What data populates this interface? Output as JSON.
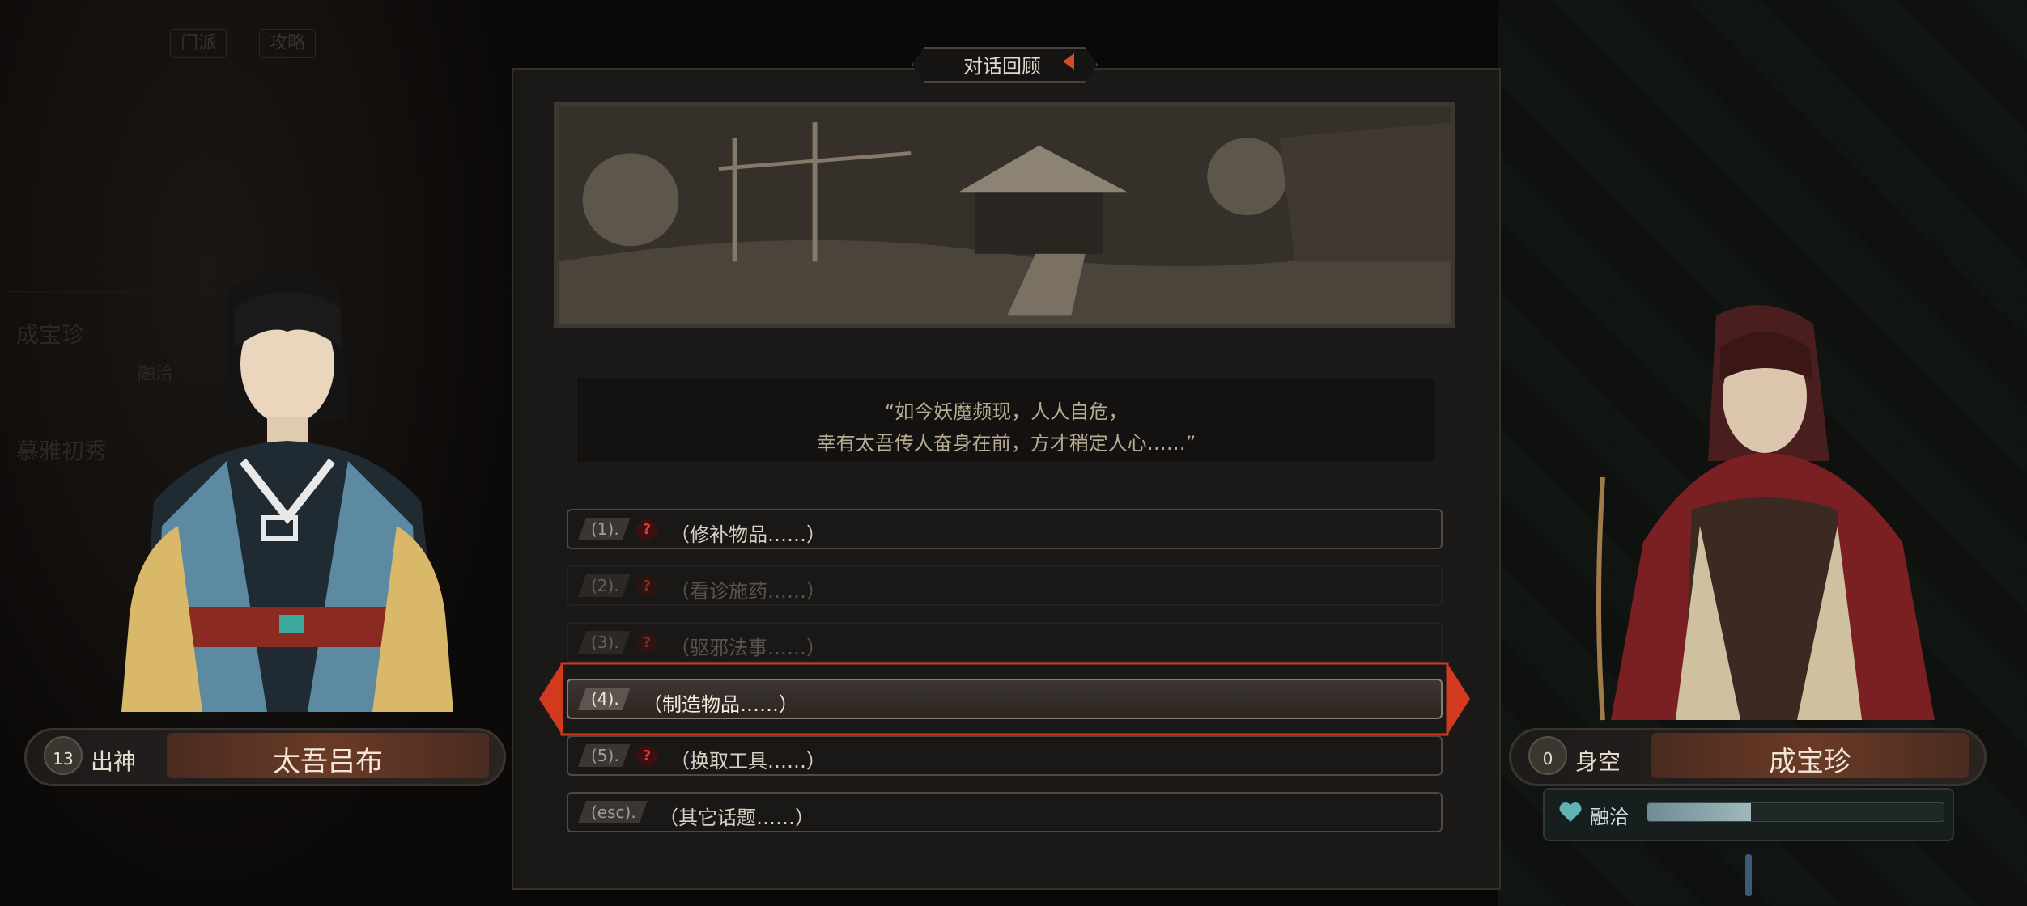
{
  "background": {
    "top_tabs": [
      "门派",
      "攻略"
    ],
    "left_list": [
      {
        "name": "成宝珍",
        "relation": "融洽"
      },
      {
        "name": "慕雅初秀",
        "relation": ""
      }
    ],
    "left_relation_label": "融洽"
  },
  "dialog": {
    "title": "对话回顾",
    "quote_lines": [
      "“如今妖魔频现，人人自危，",
      "幸有太吾传人奋身在前，方才稍定人心……”"
    ],
    "options": [
      {
        "key": "(1).",
        "label": "（修补物品……）",
        "locked": true,
        "dim": false,
        "selected": false
      },
      {
        "key": "(2).",
        "label": "（看诊施药……）",
        "locked": true,
        "dim": true,
        "selected": false
      },
      {
        "key": "(3).",
        "label": "（驱邪法事……）",
        "locked": true,
        "dim": true,
        "selected": false
      },
      {
        "key": "(4).",
        "label": "（制造物品……）",
        "locked": false,
        "dim": false,
        "selected": true
      },
      {
        "key": "(5).",
        "label": "（换取工具……）",
        "locked": true,
        "dim": false,
        "selected": false
      },
      {
        "key": "(esc).",
        "label": "（其它话题……）",
        "locked": false,
        "dim": false,
        "selected": false
      }
    ],
    "locked_glyph": "?"
  },
  "player": {
    "rank_level": "13",
    "title": "出神",
    "name": "太吾吕布"
  },
  "npc": {
    "rank_level": "0",
    "title": "身空",
    "name": "成宝珍",
    "relation_label": "融洽",
    "relation_progress": 0.35
  },
  "colors": {
    "accent_red": "#d64b2a",
    "panel_bg": "#1b1918",
    "relation_fill": "#9fb7bd"
  }
}
